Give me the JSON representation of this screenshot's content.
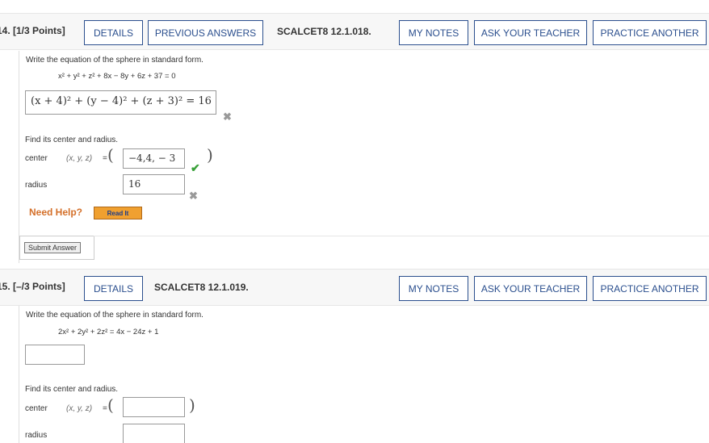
{
  "q14": {
    "number": "14. [1/3 Points]",
    "details": "DETAILS",
    "previous_answers": "PREVIOUS ANSWERS",
    "code": "SCALCET8 12.1.018.",
    "my_notes": "MY NOTES",
    "ask_teacher": "ASK YOUR TEACHER",
    "practice_another": "PRACTICE ANOTHER",
    "prompt": "Write the equation of the sphere in standard form.",
    "equation": "x² + y² + z² + 8x − 8y + 6z + 37 = 0",
    "answer_equation": "(x + 4)² + (y − 4)² + (z + 3)² = 16",
    "find_text": "Find its center and radius.",
    "center_label": "center",
    "center_vars": "(x, y, z)",
    "eq_sign": "=",
    "center_value": "−4,4, − 3",
    "radius_label": "radius",
    "radius_value": "16",
    "need_help": "Need Help?",
    "read_it": "Read It",
    "submit": "Submit Answer"
  },
  "q15": {
    "number": "15. [–/3 Points]",
    "details": "DETAILS",
    "code": "SCALCET8 12.1.019.",
    "my_notes": "MY NOTES",
    "ask_teacher": "ASK YOUR TEACHER",
    "practice_another": "PRACTICE ANOTHER",
    "prompt": "Write the equation of the sphere in standard form.",
    "equation": "2x² + 2y² + 2z² = 4x − 24z + 1",
    "answer_equation": "",
    "find_text": "Find its center and radius.",
    "center_label": "center",
    "center_vars": "(x, y, z)",
    "eq_sign": "=",
    "center_value": "",
    "radius_label": "radius",
    "radius_value": ""
  },
  "colors": {
    "button_border": "#2b4f8e",
    "correct": "#3aa13a",
    "incorrect": "#999999",
    "need_help": "#d4702a",
    "read_it_bg": "#f0a030"
  }
}
